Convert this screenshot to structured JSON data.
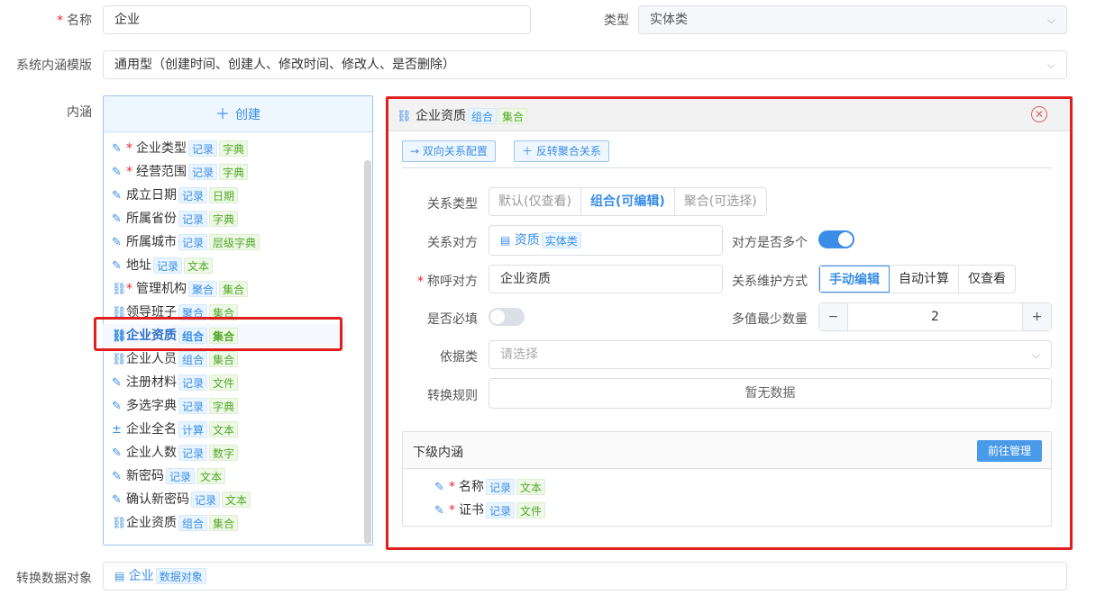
{
  "form": {
    "name_label": "名称",
    "name_value": "企业",
    "type_label": "类型",
    "type_value": "实体类",
    "template_label": "系统内涵模版",
    "template_value": "通用型（创建时间、创建人、修改时间、修改人、是否删除）",
    "connotation_label": "内涵",
    "transform_label": "转换数据对象",
    "transform_value": "企业",
    "transform_tag": "数据对象"
  },
  "list": {
    "create_label": "创建",
    "items": [
      {
        "name": "企业类型",
        "icon": "edit-icon",
        "required": true,
        "tags": [
          "记录",
          "字典"
        ]
      },
      {
        "name": "经营范围",
        "icon": "edit-icon",
        "required": true,
        "tags": [
          "记录",
          "字典"
        ]
      },
      {
        "name": "成立日期",
        "icon": "edit-icon",
        "required": false,
        "tags": [
          "记录",
          "日期"
        ]
      },
      {
        "name": "所属省份",
        "icon": "edit-icon",
        "required": false,
        "tags": [
          "记录",
          "字典"
        ]
      },
      {
        "name": "所属城市",
        "icon": "edit-icon",
        "required": false,
        "tags": [
          "记录",
          "层级字典"
        ]
      },
      {
        "name": "地址",
        "icon": "edit-icon",
        "required": false,
        "tags": [
          "记录",
          "文本"
        ]
      },
      {
        "name": "管理机构",
        "icon": "link-icon",
        "required": true,
        "tags": [
          "聚合",
          "集合"
        ]
      },
      {
        "name": "领导班子",
        "icon": "link-icon",
        "required": false,
        "tags": [
          "聚合",
          "集合"
        ]
      },
      {
        "name": "企业资质",
        "icon": "link-icon",
        "required": false,
        "tags": [
          "组合",
          "集合"
        ],
        "selected": true
      },
      {
        "name": "企业人员",
        "icon": "link-icon",
        "required": false,
        "tags": [
          "组合",
          "集合"
        ]
      },
      {
        "name": "注册材料",
        "icon": "edit-icon",
        "required": false,
        "tags": [
          "记录",
          "文件"
        ]
      },
      {
        "name": "多选字典",
        "icon": "edit-icon",
        "required": false,
        "tags": [
          "记录",
          "字典"
        ]
      },
      {
        "name": "企业全名",
        "icon": "calc-icon",
        "required": false,
        "tags": [
          "计算",
          "文本"
        ]
      },
      {
        "name": "企业人数",
        "icon": "edit-icon",
        "required": false,
        "tags": [
          "记录",
          "数字"
        ]
      },
      {
        "name": "新密码",
        "icon": "edit-icon",
        "required": false,
        "tags": [
          "记录",
          "文本"
        ]
      },
      {
        "name": "确认新密码",
        "icon": "edit-icon",
        "required": false,
        "tags": [
          "记录",
          "文本"
        ]
      },
      {
        "name": "企业资质",
        "icon": "link-icon",
        "required": false,
        "tags": [
          "组合",
          "集合"
        ]
      }
    ]
  },
  "panel": {
    "title": "企业资质",
    "title_tags": [
      "组合",
      "集合"
    ],
    "btn_bidirectional": "双向关系配置",
    "btn_reverse": "反转聚合关系",
    "rel_type_label": "关系类型",
    "rel_type_options": [
      "默认(仅查看)",
      "组合(可编辑)",
      "聚合(可选择)"
    ],
    "rel_type_selected": "组合(可编辑)",
    "counterpart_label": "关系对方",
    "counterpart_value": "资质",
    "counterpart_tag": "实体类",
    "multi_label": "对方是否多个",
    "multi_on": true,
    "alias_label": "称呼对方",
    "alias_value": "企业资质",
    "maintain_label": "关系维护方式",
    "maintain_options": [
      "手动编辑",
      "自动计算",
      "仅查看"
    ],
    "maintain_selected": "手动编辑",
    "required_label": "是否必填",
    "required_on": false,
    "min_label": "多值最少数量",
    "min_value": "2",
    "minus": "−",
    "plus": "+",
    "basis_label": "依据类",
    "basis_placeholder": "请选择",
    "rule_label": "转换规则",
    "rule_empty": "暂无数据",
    "sub_title": "下级内涵",
    "sub_manage": "前往管理",
    "sub_items": [
      {
        "name": "名称",
        "tags": [
          "记录",
          "文本"
        ]
      },
      {
        "name": "证书",
        "tags": [
          "记录",
          "文件"
        ]
      }
    ]
  },
  "colors": {
    "accent": "#3a8ee6",
    "highlight": "#e02020"
  }
}
